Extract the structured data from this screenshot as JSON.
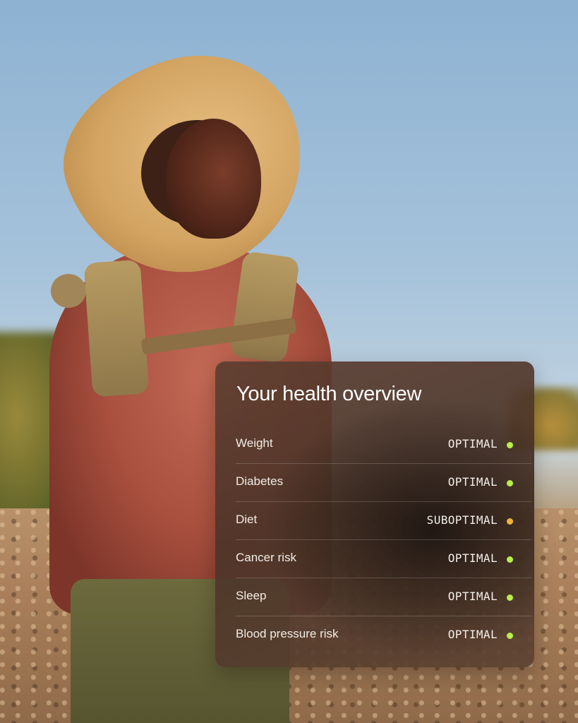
{
  "card": {
    "title": "Your health overview",
    "rows": [
      {
        "label": "Weight",
        "status": "OPTIMAL",
        "dot_color": "#b7ef4a"
      },
      {
        "label": "Diabetes",
        "status": "OPTIMAL",
        "dot_color": "#b7ef4a"
      },
      {
        "label": "Diet",
        "status": "SUBOPTIMAL",
        "dot_color": "#f2b33a"
      },
      {
        "label": "Cancer risk",
        "status": "OPTIMAL",
        "dot_color": "#b7ef4a"
      },
      {
        "label": "Sleep",
        "status": "OPTIMAL",
        "dot_color": "#b7ef4a"
      },
      {
        "label": "Blood pressure risk",
        "status": "OPTIMAL",
        "dot_color": "#b7ef4a"
      }
    ]
  }
}
